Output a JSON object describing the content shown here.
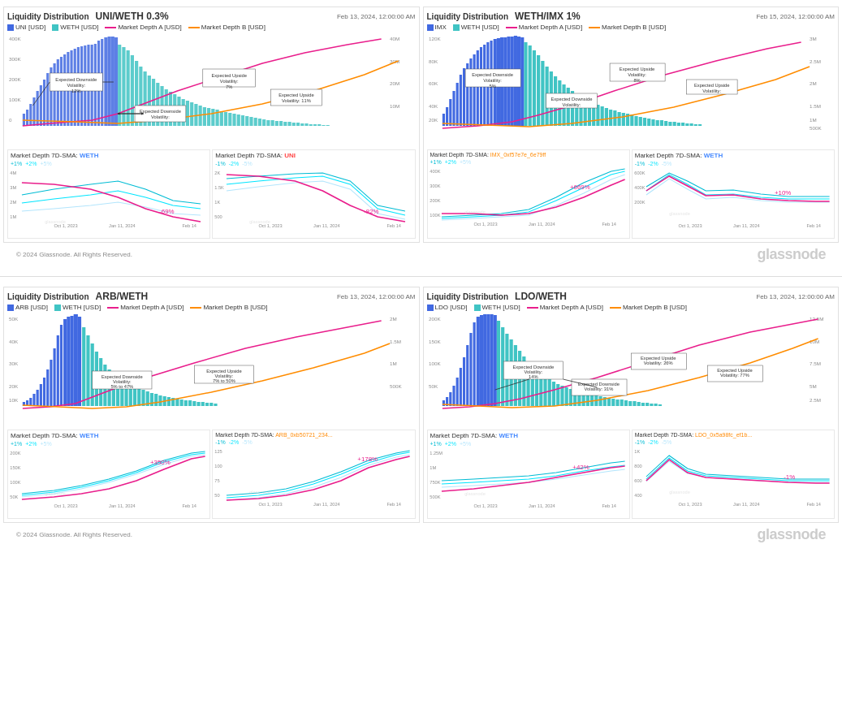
{
  "top_left": {
    "title": "Liquidity Distribution",
    "pair": "UNI/WETH 0.3%",
    "timestamp": "Feb 13, 2024, 12:00:00 AM",
    "legend": [
      {
        "label": "UNI [USD]",
        "color": "#4169e1",
        "type": "bar"
      },
      {
        "label": "WETH [USD]",
        "color": "#40c4c4",
        "type": "bar"
      },
      {
        "label": "Market Depth A [USD]",
        "color": "#e91e8c",
        "type": "line"
      },
      {
        "label": "Market Depth B [USD]",
        "color": "#ff8c00",
        "type": "line"
      }
    ],
    "annotations": [
      {
        "label": "Expected Downside Volatility:",
        "value": "12%"
      },
      {
        "label": "Expected Downside Volatility:",
        "value": ""
      },
      {
        "label": "Expected Upside Volatility:",
        "value": "7%"
      },
      {
        "label": "Expected Upside Volatility:",
        "value": "11%"
      }
    ]
  },
  "top_right": {
    "title": "Liquidity Distribution",
    "pair": "WETH/IMX 1%",
    "timestamp": "Feb 15, 2024, 12:00:00 AM",
    "legend": [
      {
        "label": "IMX",
        "color": "#4169e1",
        "type": "bar"
      },
      {
        "label": "WETH [USD]",
        "color": "#40c4c4",
        "type": "bar"
      },
      {
        "label": "Market Depth A [USD]",
        "color": "#e91e8c",
        "type": "line"
      },
      {
        "label": "Market Depth B [USD]",
        "color": "#ff8c00",
        "type": "line"
      }
    ],
    "annotations": [
      {
        "label": "Expected Downside Volatility:",
        "value": "5%"
      },
      {
        "label": "Expected Downside Volatility:",
        "value": ""
      },
      {
        "label": "Expected Upside Volatility:",
        "value": "8%"
      },
      {
        "label": "Expected Upside Volatility:",
        "value": ""
      }
    ]
  },
  "depth_top_left_1": {
    "title": "Market Depth 7D-SMA:",
    "token": "WETH",
    "token_color": "blue",
    "change": "-69%",
    "change_color": "red",
    "legend": [
      "+1%",
      "+2%",
      "+5%"
    ]
  },
  "depth_top_left_2": {
    "title": "Market Depth 7D-SMA:",
    "token": "UNI",
    "token_color": "red",
    "change": "-82%",
    "change_color": "red",
    "legend": [
      "-1%",
      "-2%",
      "-5%"
    ]
  },
  "depth_top_right_1": {
    "title": "Market Depth 7D-SMA: IMX_0xf57e7e_6e79ff",
    "token": "",
    "token_color": "orange",
    "change": "+669%",
    "change_color": "red",
    "legend": [
      "+1%",
      "+2%",
      "+5%"
    ]
  },
  "depth_top_right_2": {
    "title": "Market Depth 7D-SMA:",
    "token": "WETH",
    "token_color": "blue",
    "change": "+10%",
    "change_color": "red",
    "legend": [
      "-1%",
      "-2%",
      "-5%"
    ]
  },
  "bottom_left": {
    "title": "Liquidity Distribution",
    "pair": "ARB/WETH",
    "timestamp": "Feb 13, 2024, 12:00:00 AM",
    "legend": [
      {
        "label": "ARB [USD]",
        "color": "#4169e1",
        "type": "bar"
      },
      {
        "label": "WETH [USD]",
        "color": "#40c4c4",
        "type": "bar"
      },
      {
        "label": "Market Depth A [USD]",
        "color": "#e91e8c",
        "type": "line"
      },
      {
        "label": "Market Depth B [USD]",
        "color": "#ff8c00",
        "type": "line"
      }
    ],
    "annotations": [
      {
        "label": "Expected Downside Volatility:",
        "value": "5% to 47%"
      },
      {
        "label": "Expected Upside Volatility:",
        "value": "7% to 50%"
      }
    ]
  },
  "bottom_right": {
    "title": "Liquidity Distribution",
    "pair": "LDO/WETH",
    "timestamp": "Feb 13, 2024, 12:00:00 AM",
    "legend": [
      {
        "label": "LDO [USD]",
        "color": "#4169e1",
        "type": "bar"
      },
      {
        "label": "WETH [USD]",
        "color": "#40c4c4",
        "type": "bar"
      },
      {
        "label": "Market Depth A [USD]",
        "color": "#e91e8c",
        "type": "line"
      },
      {
        "label": "Market Depth B [USD]",
        "color": "#ff8c00",
        "type": "line"
      }
    ],
    "annotations": [
      {
        "label": "Expected Downside Volatility:",
        "value": "14%"
      },
      {
        "label": "Expected Downside Volatility:",
        "value": "31%"
      },
      {
        "label": "Expected Upside Volatility:",
        "value": "26%"
      },
      {
        "label": "Expected Upside Volatility:",
        "value": "77%"
      }
    ]
  },
  "depth_bottom_left_1": {
    "title": "Market Depth 7D-SMA:",
    "token": "WETH",
    "token_color": "blue",
    "change": "+350%",
    "change_color": "red",
    "legend": [
      "+1%",
      "+2%",
      "+5%"
    ]
  },
  "depth_bottom_left_2": {
    "title": "Market Depth 7D-SMA: ARB_0xb50721_234...",
    "token": "",
    "token_color": "orange",
    "change": "+178%",
    "change_color": "red",
    "legend": [
      "-1%",
      "-2%",
      "-5%"
    ]
  },
  "depth_bottom_right_1": {
    "title": "Market Depth 7D-SMA:",
    "token": "WETH",
    "token_color": "blue",
    "change": "+42%",
    "change_color": "red",
    "legend": [
      "+1%",
      "+2%",
      "+5%"
    ]
  },
  "depth_bottom_right_2": {
    "title": "Market Depth 7D-SMA: LDO_0x5a98fc_ef1b...",
    "token": "",
    "token_color": "orange",
    "change": "-1%",
    "change_color": "red",
    "legend": [
      "-1%",
      "-2%",
      "-5%"
    ]
  },
  "footer": {
    "copyright": "© 2024 Glassnode. All Rights Reserved.",
    "brand": "glassnode"
  }
}
